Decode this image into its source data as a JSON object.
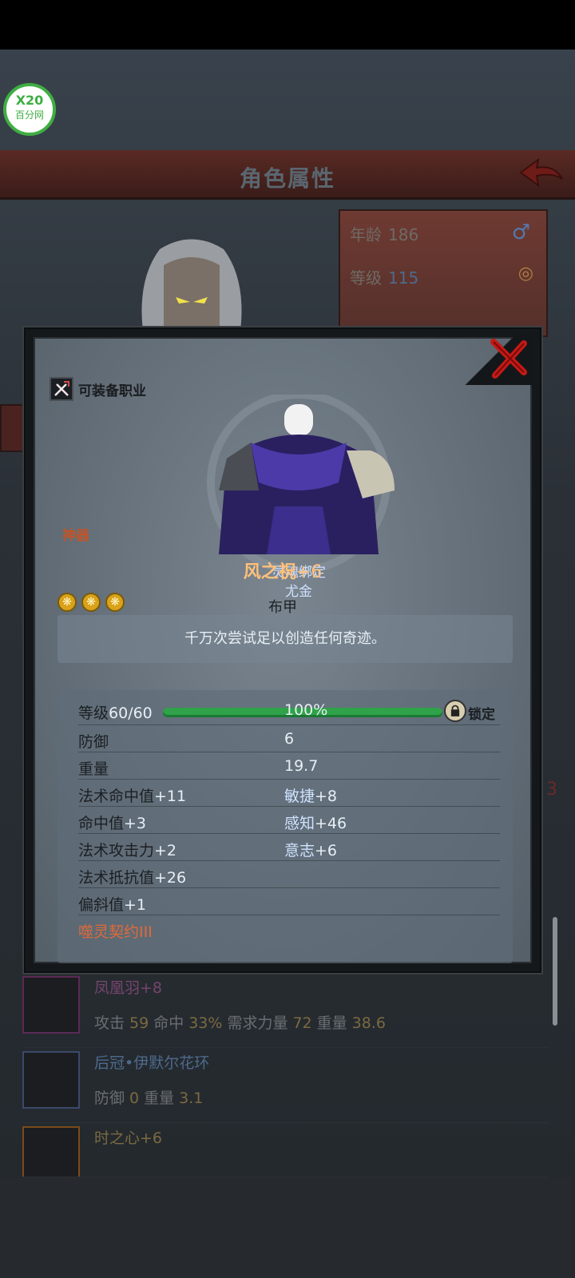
{
  "watermark": {
    "top": "X20",
    "bottom": "百分网"
  },
  "header": {
    "title": "角色属性"
  },
  "character": {
    "age_label": "年龄",
    "age": "186",
    "level_label": "等级",
    "level": "115"
  },
  "side_number": "3",
  "list": [
    {
      "name": "凤凰羽+8",
      "stats": [
        {
          "k": "攻击",
          "v": "59"
        },
        {
          "k": "命中",
          "v": "33%"
        },
        {
          "k": "需求力量",
          "v": "72"
        },
        {
          "k": "重量",
          "v": "38.6"
        }
      ]
    },
    {
      "name": "后冠•伊默尔花环",
      "stats": [
        {
          "k": "防御",
          "v": "0"
        },
        {
          "k": "重量",
          "v": "3.1"
        }
      ]
    },
    {
      "name": "时之心+6",
      "stats": []
    }
  ],
  "item": {
    "job_label": "可装备职业",
    "artifact_label": "神器",
    "bound_label": "灵魂绑定",
    "bound_kind": "尤金",
    "name": "风之祝",
    "enhance": "+6",
    "armor_type": "布甲",
    "description": "千万次尝试足以创造任何奇迹。",
    "level_label": "等级",
    "level_value": "60/60",
    "level_percent": "100%",
    "level_fraction": 1.0,
    "lock_label": "锁定",
    "stats": [
      {
        "left_label": "防御",
        "left_value": "",
        "right": "6"
      },
      {
        "left_label": "重量",
        "left_value": "",
        "right": "19.7"
      },
      {
        "left_label": "法术命中值",
        "left_value": "+11",
        "right_label": "敏捷",
        "right_value": "+8"
      },
      {
        "left_label": "命中值",
        "left_value": "+3",
        "right_label": "感知",
        "right_value": "+46"
      },
      {
        "left_label": "法术攻击力",
        "left_value": "+2",
        "right_label": "意志",
        "right_value": "+6"
      },
      {
        "left_label": "法术抵抗值",
        "left_value": "+26"
      },
      {
        "left_label": "偏斜值",
        "left_value": "+1"
      }
    ],
    "curse": "噬灵契约III"
  },
  "colors": {
    "accent_orange": "#ffc07a",
    "curse": "#e06a3a",
    "bar_green": "#2fa24a"
  }
}
